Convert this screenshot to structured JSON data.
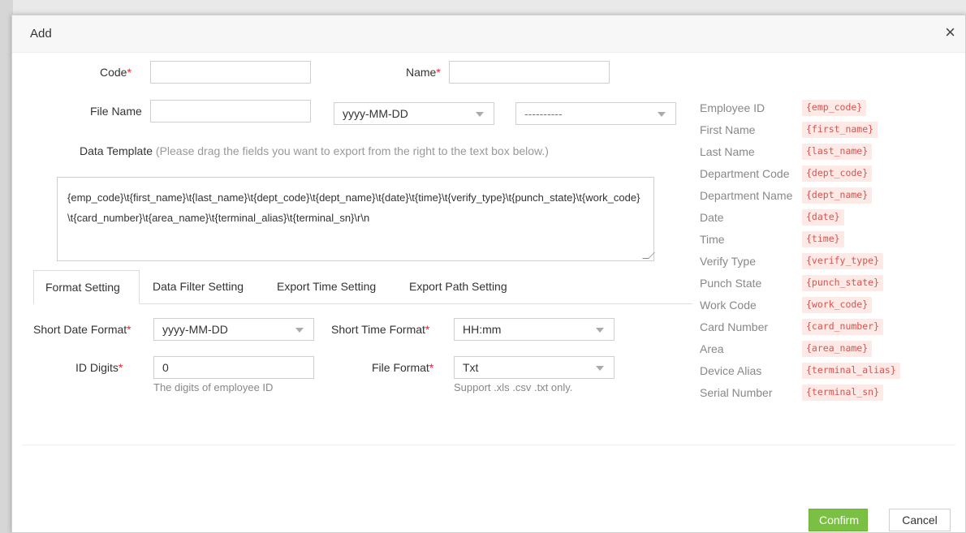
{
  "dialog": {
    "title": "Add",
    "close_icon": "×"
  },
  "form": {
    "code_label": "Code",
    "name_label": "Name",
    "file_name_label": "File Name",
    "date_format_select": "yyyy-MM-DD",
    "separator_select": "----------",
    "required_mark": "*"
  },
  "data_template": {
    "label": "Data Template",
    "hint": "(Please drag the fields you want to export from the right to the text box below.)",
    "value": "{emp_code}\\t{first_name}\\t{last_name}\\t{dept_code}\\t{dept_name}\\t{date}\\t{time}\\t{verify_type}\\t{punch_state}\\t{work_code}\\t{card_number}\\t{area_name}\\t{terminal_alias}\\t{terminal_sn}\\r\\n"
  },
  "tabs": [
    {
      "label": "Format Setting",
      "active": true
    },
    {
      "label": "Data Filter Setting",
      "active": false
    },
    {
      "label": "Export Time Setting",
      "active": false
    },
    {
      "label": "Export Path Setting",
      "active": false
    }
  ],
  "format_setting": {
    "short_date_label": "Short Date Format",
    "short_date_value": "yyyy-MM-DD",
    "short_time_label": "Short Time Format",
    "short_time_value": "HH:mm",
    "id_digits_label": "ID Digits",
    "id_digits_value": "0",
    "id_digits_hint": "The digits of employee ID",
    "file_format_label": "File Format",
    "file_format_value": "Txt",
    "file_format_hint": "Support .xls .csv .txt only."
  },
  "fields": [
    {
      "name": "Employee ID",
      "tag": "{emp_code}"
    },
    {
      "name": "First Name",
      "tag": "{first_name}"
    },
    {
      "name": "Last Name",
      "tag": "{last_name}"
    },
    {
      "name": "Department Code",
      "tag": "{dept_code}"
    },
    {
      "name": "Department Name",
      "tag": "{dept_name}"
    },
    {
      "name": "Date",
      "tag": "{date}"
    },
    {
      "name": "Time",
      "tag": "{time}"
    },
    {
      "name": "Verify Type",
      "tag": "{verify_type}"
    },
    {
      "name": "Punch State",
      "tag": "{punch_state}"
    },
    {
      "name": "Work Code",
      "tag": "{work_code}"
    },
    {
      "name": "Card Number",
      "tag": "{card_number}"
    },
    {
      "name": "Area",
      "tag": "{area_name}"
    },
    {
      "name": "Device Alias",
      "tag": "{terminal_alias}"
    },
    {
      "name": "Serial Number",
      "tag": "{terminal_sn}"
    }
  ],
  "buttons": {
    "confirm": "Confirm",
    "cancel": "Cancel"
  },
  "colors": {
    "accent": "#7ac143",
    "required": "#e23",
    "tag_bg": "#fde9e6",
    "tag_text": "#d9534f"
  }
}
